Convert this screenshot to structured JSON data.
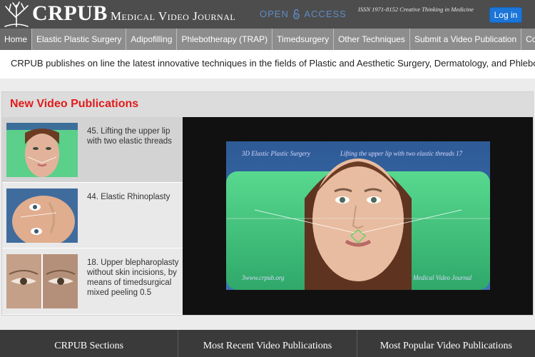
{
  "header": {
    "logo_main": "CRPUB",
    "logo_sub": "Medical Video Journal",
    "open_access_prefix": "OPEN",
    "open_access_suffix": "ACCESS",
    "issn": "ISSN 1971-8152 Creative Thinking in Medicine",
    "login_label": "Log in"
  },
  "nav": [
    "Home",
    "Elastic Plastic Surgery",
    "Adipofilling",
    "Phlebotherapy (TRAP)",
    "Timedsurgery",
    "Other Techniques",
    "Submit a Video Publication",
    "Contact"
  ],
  "tagline": "CRPUB publishes on line the latest innovative techniques in the fields of Plastic and Aesthetic Surgery, Dermatology, and Phlebology",
  "publications": {
    "title": "New Video Publications",
    "items": [
      {
        "title": "45. Lifting the upper lip with two elastic threads"
      },
      {
        "title": "44. Elastic Rhinoplasty"
      },
      {
        "title": "18. Upper blepharoplasty without skin incisions, by means of timedsurgical mixed peeling 0.5"
      }
    ],
    "video": {
      "caption_left": "3D Elastic Plastic Surgery",
      "caption_right": "Lifting the upper lip with two elastic threads 17",
      "caption_bottom_left": "3www.crpub.org",
      "caption_bottom_right": "Medical Video Journal"
    }
  },
  "footer": [
    "CRPUB Sections",
    "Most Recent Video Publications",
    "Most Popular Video Publications"
  ],
  "colors": {
    "accent_red": "#e21b1b",
    "login_blue": "#1c75d8",
    "header_bg": "#4d4d4d",
    "nav_bg": "#8d8d8d"
  }
}
